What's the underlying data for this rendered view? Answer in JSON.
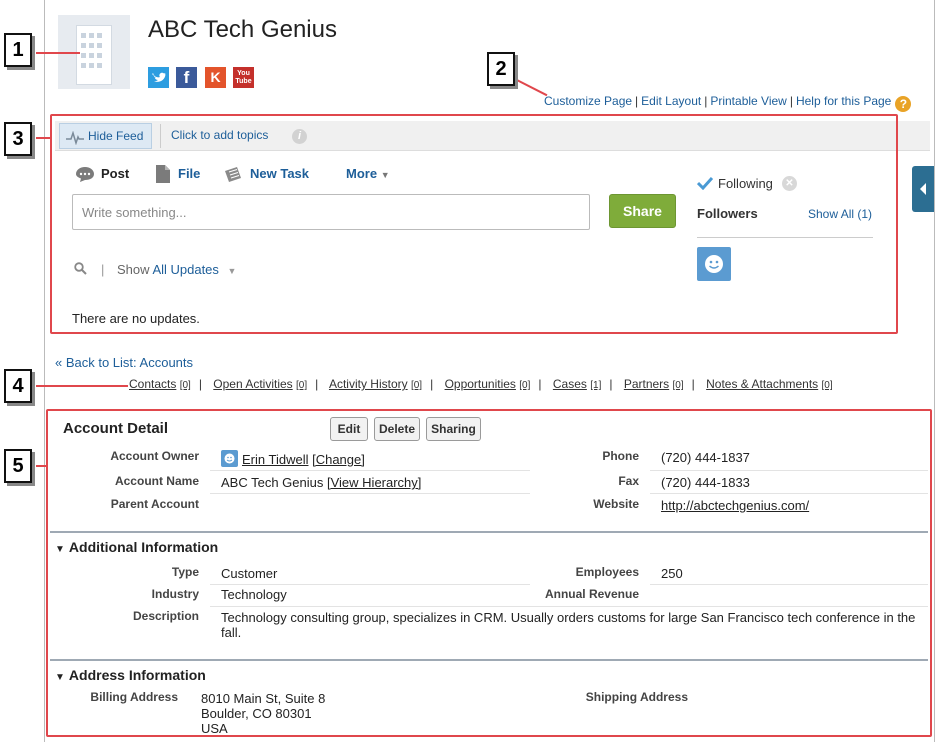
{
  "header": {
    "title": "ABC Tech Genius",
    "social": [
      {
        "name": "twitter-icon",
        "glyph": "t",
        "color": "#2d9de0"
      },
      {
        "name": "facebook-icon",
        "glyph": "f",
        "color": "#3b5a9a"
      },
      {
        "name": "klout-icon",
        "glyph": "K",
        "color": "#e3542b"
      },
      {
        "name": "youtube-icon",
        "glyph": "You\nTube",
        "color": "#c4302b"
      }
    ]
  },
  "callouts": [
    "1",
    "2",
    "3",
    "4",
    "5"
  ],
  "toplinks": {
    "customize": "Customize Page",
    "edit_layout": "Edit Layout",
    "printable": "Printable View",
    "help": "Help for this Page",
    "sep": "|",
    "help_glyph": "?"
  },
  "feed": {
    "hide_feed": "Hide Feed",
    "add_topics": "Click to add topics",
    "info_glyph": "i",
    "tabs": {
      "post": "Post",
      "file": "File",
      "new_task": "New Task",
      "more": "More"
    },
    "placeholder": "Write something...",
    "share": "Share",
    "show": "Show",
    "all_updates": "All Updates",
    "pipe": "|",
    "no_updates": "There are no updates.",
    "following": "Following",
    "followers": "Followers",
    "show_all": "Show All (1)"
  },
  "back_link": "« Back to List: Accounts",
  "related": [
    {
      "label": "Contacts",
      "count": "[0]"
    },
    {
      "label": "Open Activities",
      "count": "[0]"
    },
    {
      "label": "Activity History",
      "count": "[0]"
    },
    {
      "label": "Opportunities",
      "count": "[0]"
    },
    {
      "label": "Cases",
      "count": "[1]"
    },
    {
      "label": "Partners",
      "count": "[0]"
    },
    {
      "label": "Notes & Attachments",
      "count": "[0]"
    }
  ],
  "detail": {
    "title": "Account Detail",
    "buttons": {
      "edit": "Edit",
      "delete": "Delete",
      "sharing": "Sharing"
    },
    "account_owner_label": "Account Owner",
    "account_owner": "Erin Tidwell",
    "change": "[Change]",
    "account_name_label": "Account Name",
    "account_name": "ABC Tech Genius",
    "view_hierarchy": "[View Hierarchy]",
    "parent_account_label": "Parent Account",
    "phone_label": "Phone",
    "phone": "(720) 444-1837",
    "fax_label": "Fax",
    "fax": "(720) 444-1833",
    "website_label": "Website",
    "website": "http://abctechgenius.com/"
  },
  "additional": {
    "heading": "Additional Information",
    "type_label": "Type",
    "type": "Customer",
    "industry_label": "Industry",
    "industry": "Technology",
    "description_label": "Description",
    "description": "Technology consulting group, specializes in CRM. Usually orders customs for large San Francisco tech conference in the fall.",
    "employees_label": "Employees",
    "employees": "250",
    "revenue_label": "Annual Revenue"
  },
  "address": {
    "heading": "Address Information",
    "billing_label": "Billing Address",
    "billing_line1": "8010 Main St, Suite 8",
    "billing_line2": "Boulder, CO 80301",
    "billing_line3": "USA",
    "shipping_label": "Shipping Address"
  },
  "colors": {
    "accent": "#1d5e99",
    "share_green": "#7fac3a",
    "callout_red": "#e0474c"
  }
}
